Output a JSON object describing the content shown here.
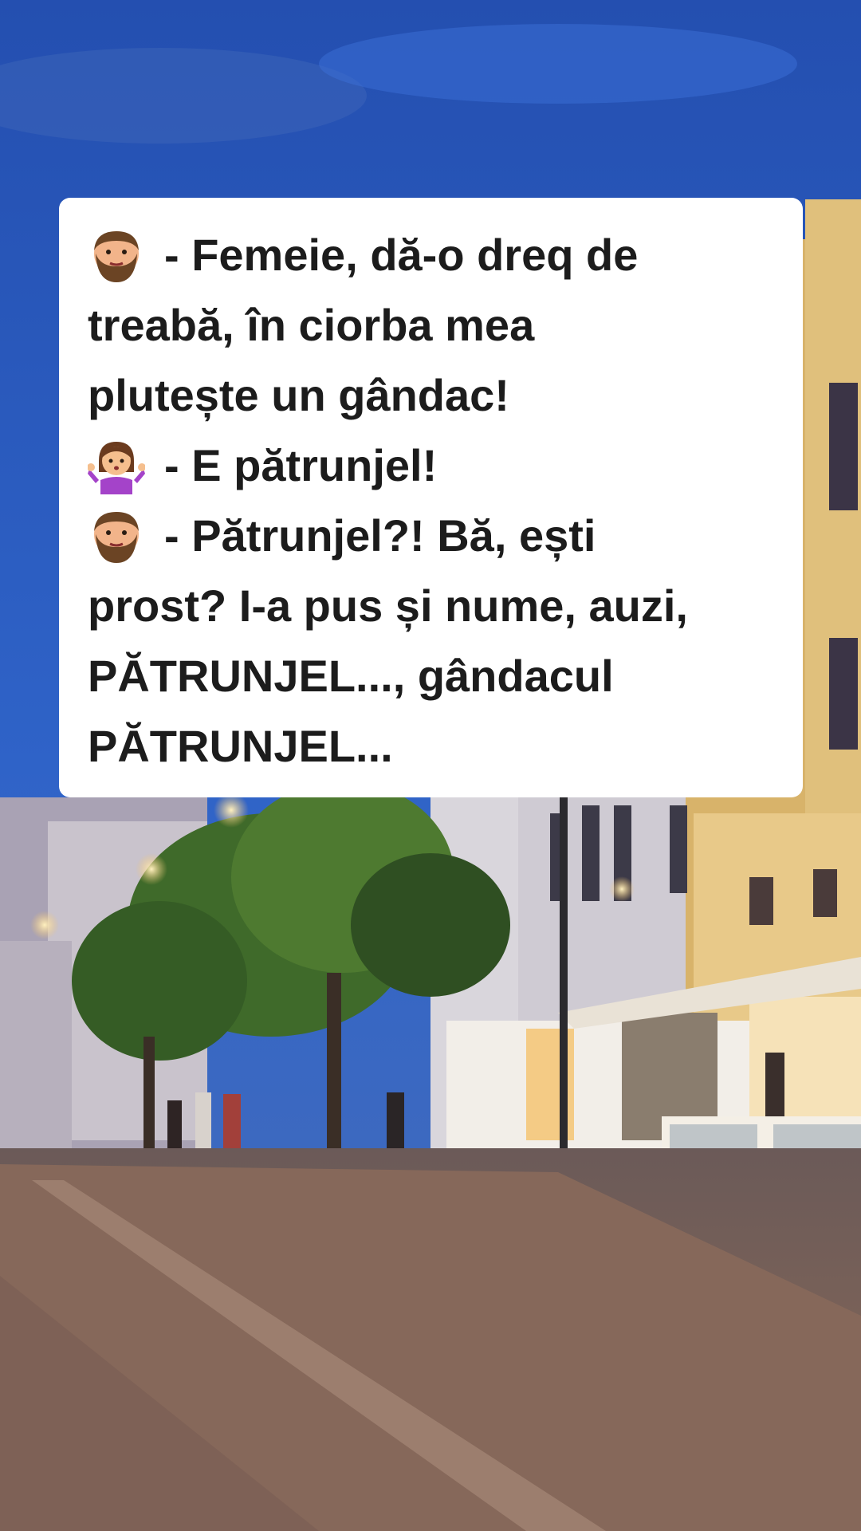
{
  "joke": {
    "lines": [
      {
        "text": "- Femeie, dă-o dreq de",
        "icon": "bearded-man-emoji"
      },
      {
        "text": "treabă, în ciorba mea"
      },
      {
        "text": "plutește un gândac!"
      },
      {
        "text": "- E pătrunjel!",
        "icon": "woman-shrugging-emoji"
      },
      {
        "text": "- Pătrunjel?! Bă, ești",
        "icon": "bearded-man-emoji"
      },
      {
        "text": "prost? I-a pus și nume, auzi,"
      },
      {
        "text": "PĂTRUNJEL..., gândacul"
      },
      {
        "text": "PĂTRUNJEL..."
      }
    ]
  },
  "colors": {
    "card_background": "#ffffff",
    "text": "#1c1c1c",
    "sky": "#2f62c8",
    "street_lights": "#f3c26b"
  }
}
